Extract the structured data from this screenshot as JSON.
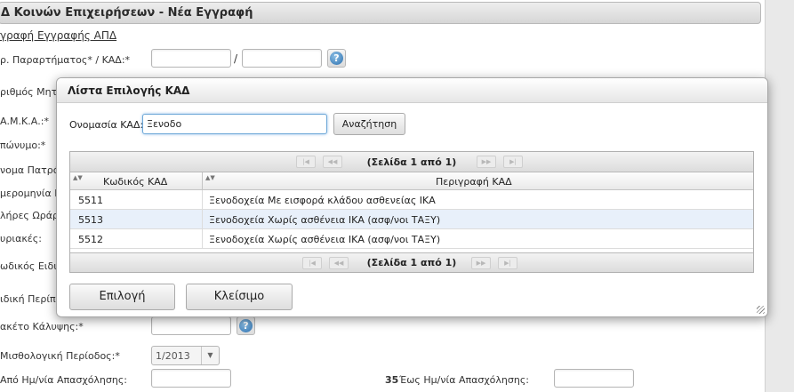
{
  "page": {
    "header": "Δ Κοινών Επιχειρήσεων - Νέα Εγγραφή",
    "sub_link": "γραφή Εγγραφής ΑΠΔ",
    "labels": {
      "branch_kad": "ρ. Παραρτήματος* / ΚΑΔ:*",
      "registry_no": "ριθμός Μητρ",
      "amka": "Α.Μ.Κ.Α.:*",
      "surname": "πώνυμο:*",
      "father_name": "νομα Πατρό",
      "date": "μερομηνία Γε",
      "full_hours": "λήρες Ωράρ",
      "sundays": "υριακές:",
      "special_code": "ωδικός Ειδικ",
      "special_case": "ιδική Περίπτ",
      "coverage_package": "ακέτο Κάλυψης:*",
      "payroll_period": "Μισθολογική Περίοδος:*",
      "employment_from": "Από Ημ/νία Απασχόλησης:",
      "employment_to_num": "35",
      "employment_to": "Έως Ημ/νία Απασχόλησης:"
    },
    "slash": "/",
    "help_glyph": "?",
    "period_value": "1/2013",
    "period_arrow": "▼"
  },
  "modal": {
    "title": "Λίστα Επιλογής ΚΑΔ",
    "search_label": "Ονομασία ΚΑΔ:",
    "search_value": "Ξενοδο",
    "search_button": "Αναζήτηση",
    "pager_top": "(Σελίδα 1 από 1)",
    "pager_bottom": "(Σελίδα 1 από 1)",
    "pager_glyphs": {
      "first": "|◀",
      "prev": "◀◀",
      "next": "▶▶",
      "last": "▶|"
    },
    "sort_glyph": "▲▼",
    "columns": [
      "Κωδικός ΚΑΔ",
      "Περιγραφή ΚΑΔ"
    ],
    "rows": [
      {
        "code": "5511",
        "description": "Ξενοδοχεία Με εισφορά κλάδου ασθενείας ΙΚΑ",
        "selected": false
      },
      {
        "code": "5513",
        "description": "Ξενοδοχεία Χωρίς ασθένεια ΙΚΑ (ασφ/νοι ΤΑΞΥ)",
        "selected": true
      },
      {
        "code": "5512",
        "description": "Ξενοδοχεία Χωρίς ασθένεια ΙΚΑ (ασφ/νοι ΤΑΞΥ)",
        "selected": false
      }
    ],
    "select_button": "Επιλογή",
    "close_button": "Κλείσιμο"
  }
}
